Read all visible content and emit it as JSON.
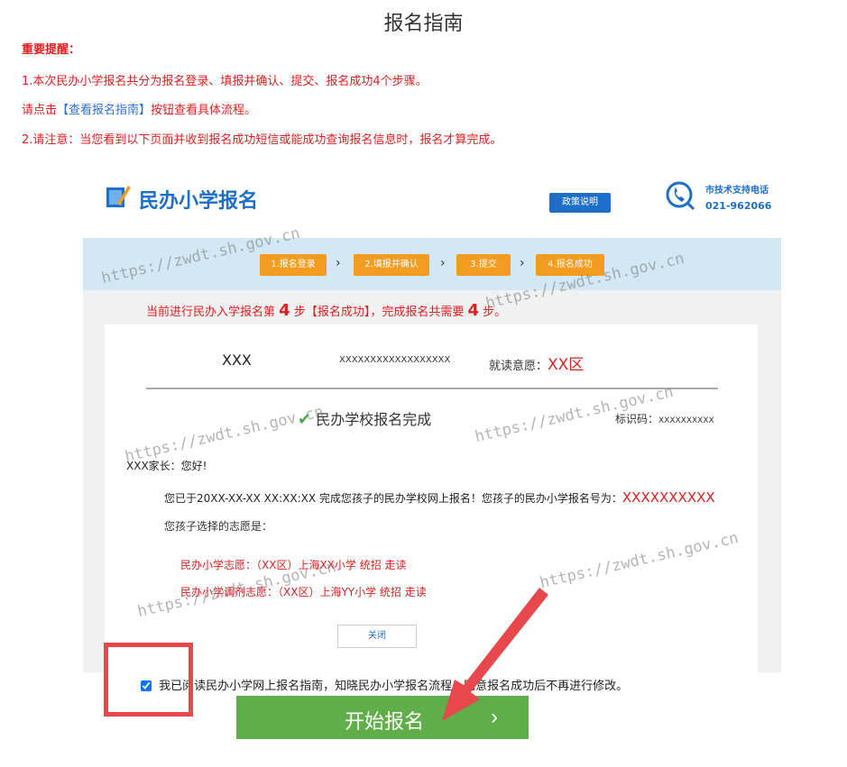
{
  "page": {
    "title": "报名指南",
    "notice_head": "重要提醒：",
    "notice1": "1.本次民办小学报名共分为报名登录、填报并确认、提交、报名成功4个步骤。",
    "notice2_pre": "请点击",
    "notice2_link": "【查看报名指南】",
    "notice2_post": "按钮查看具体流程。",
    "notice3": "2.请注意：当您看到以下页面并收到报名成功短信或能成功查询报名信息时，报名才算完成。"
  },
  "screenshot": {
    "header": {
      "logo_text": "民办小学报名",
      "policy_button": "政策说明",
      "support_label": "市技术支持电话",
      "support_phone": "021-962066"
    },
    "steps": [
      {
        "label": "1.报名登录"
      },
      {
        "label": "2.填报并确认"
      },
      {
        "label": "3.提交"
      },
      {
        "label": "4.报名成功"
      }
    ],
    "progress": {
      "pre": "当前进行民办入学报名第",
      "step": "4",
      "mid": "步【报名成功】，完成报名共需要",
      "total": "4",
      "post": "步。"
    },
    "card": {
      "name": "XXX",
      "id_number": "XXXXXXXXXXXXXXXXXX",
      "intent_label": "就读意愿：",
      "intent_value": "XX区",
      "done_title": "民办学校报名完成",
      "ident_label": "标识码：",
      "ident_value": "XXXXXXXXXX",
      "greeting": "XXX家长：您好!",
      "finish_pre": "您已于20XX-XX-XX XX:XX:XX 完成您孩子的民办学校网上报名！您孩子的民办小学报名号为：",
      "finish_number": "XXXXXXXXXX",
      "choice_label": "您孩子选择的志愿是：",
      "choice1": "民办小学志愿：（XX区）上海XX小学  统招   走读",
      "choice2": "民办小学调剂志愿：（XX区）上海YY小学 统招  走读",
      "close_button": "关闭"
    },
    "watermark": "https://zwdt.sh.gov.cn"
  },
  "agreement": {
    "checked": true,
    "text": "我已阅读民办小学网上报名指南，知晓民办小学报名流程，同意报名成功后不再进行修改。"
  },
  "start_button": {
    "label": "开始报名",
    "chevron": "›"
  },
  "colors": {
    "accent_red": "#e02020",
    "brand_blue": "#1e6fc7",
    "step_orange": "#f39c20",
    "button_green": "#5fae49",
    "highlight_box": "#e8474c"
  }
}
